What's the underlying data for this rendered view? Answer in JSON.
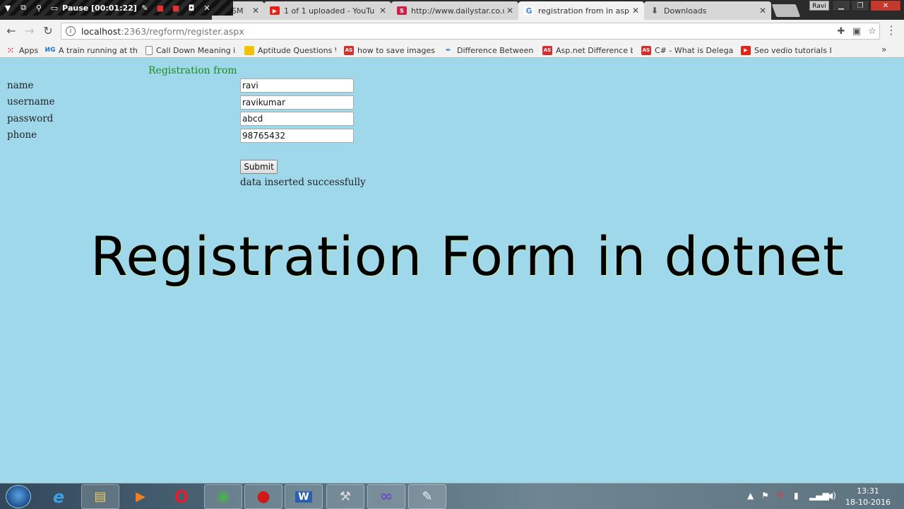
{
  "recorder": {
    "pause_label": "Pause [00:01:22]"
  },
  "tabs": [
    {
      "title": "SM",
      "favicon": "generic-page-icon"
    },
    {
      "title": "1 of 1 uploaded - YouTu",
      "favicon": "youtube-icon",
      "color": "#e62117"
    },
    {
      "title": "http://www.dailystar.co.u",
      "favicon": "dailystar-icon",
      "color": "#d11f48"
    },
    {
      "title": "registration from in asp.n",
      "favicon": "google-icon",
      "active": true
    },
    {
      "title": "Downloads",
      "favicon": "download-icon"
    }
  ],
  "window": {
    "profile_name": "Ravi"
  },
  "address_bar": {
    "host": "localhost",
    "path": ":2363/regform/register.aspx"
  },
  "bookmarks": [
    {
      "label": "Apps",
      "icon": "apps-grid-icon"
    },
    {
      "label": "A train running at the",
      "icon": "ng-icon",
      "badge": "ИG",
      "color": "#1a73c9"
    },
    {
      "label": "Call Down Meaning in",
      "icon": "page-icon"
    },
    {
      "label": "Aptitude Questions W",
      "icon": "folder-star-icon",
      "color": "#f2c200"
    },
    {
      "label": "how to save images in",
      "icon": "asp-icon",
      "badge": "AS",
      "color": "#d32f2f"
    },
    {
      "label": "Difference Between C",
      "icon": "pen-icon"
    },
    {
      "label": "Asp.net Difference be",
      "icon": "asp-icon",
      "badge": "AS",
      "color": "#d32f2f"
    },
    {
      "label": "C# - What is Delegate",
      "icon": "asp-icon",
      "badge": "AS",
      "color": "#d32f2f"
    },
    {
      "label": "Seo vedio tutorials In",
      "icon": "youtube-icon",
      "color": "#e62117"
    }
  ],
  "form": {
    "title": "Registration from",
    "fields": [
      {
        "label": "name",
        "value": "ravi"
      },
      {
        "label": "username",
        "value": "ravikumar"
      },
      {
        "label": "password",
        "value": "abcd"
      },
      {
        "label": "phone",
        "value": "98765432"
      }
    ],
    "submit_label": "Submit",
    "status_message": "data inserted successfully"
  },
  "overlay_title": "Registration Form in dotnet",
  "taskbar": {
    "apps": [
      {
        "name": "internet-explorer-icon",
        "glyph": "e",
        "color": "#3aa0e8"
      },
      {
        "name": "file-explorer-icon",
        "glyph": "▤",
        "color": "#f0c860"
      },
      {
        "name": "media-player-icon",
        "glyph": "▶",
        "color": "#f08020"
      },
      {
        "name": "opera-icon",
        "glyph": "O",
        "color": "#e0202a"
      },
      {
        "name": "chrome-icon",
        "glyph": "◉",
        "color": "#4caf50"
      },
      {
        "name": "screen-recorder-icon",
        "glyph": "●",
        "color": "#d01818"
      },
      {
        "name": "word-icon",
        "glyph": "W",
        "color": "#2b5fb0"
      },
      {
        "name": "visual-studio-setup-icon",
        "glyph": "⚒",
        "color": "#ddd"
      },
      {
        "name": "visual-studio-icon",
        "glyph": "∞",
        "color": "#6a4fc0"
      },
      {
        "name": "paint-icon",
        "glyph": "✎",
        "color": "#f0f0f0"
      }
    ],
    "clock_time": "13:31",
    "clock_date": "18-10-2016"
  }
}
